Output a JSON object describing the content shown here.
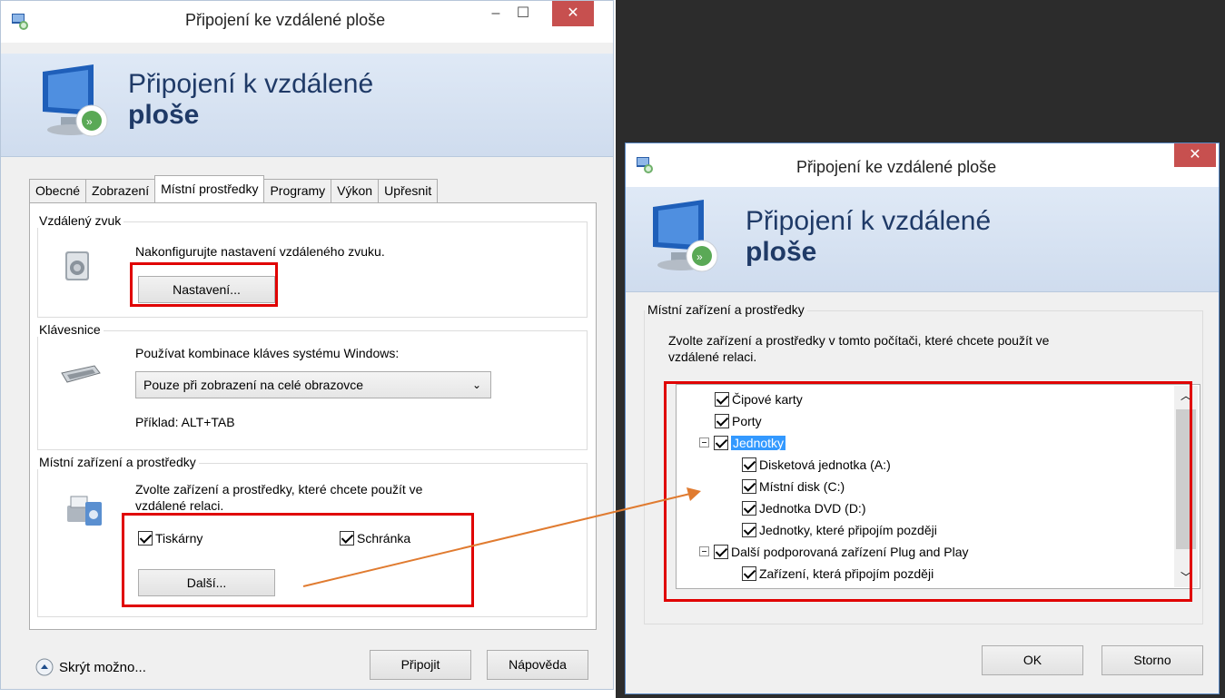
{
  "left_window": {
    "title": "Připojení ke vzdálené ploše",
    "banner_line1": "Připojení k vzdálené",
    "banner_line2": "ploše",
    "tabs": [
      "Obecné",
      "Zobrazení",
      "Místní prostředky",
      "Programy",
      "Výkon",
      "Upřesnit"
    ],
    "active_tab": "Místní prostředky",
    "audio": {
      "label": "Vzdálený zvuk",
      "description": "Nakonfigurujte nastavení vzdáleného zvuku.",
      "button": "Nastavení..."
    },
    "keyboard": {
      "label": "Klávesnice",
      "description": "Používat kombinace kláves systému Windows:",
      "selected": "Pouze při zobrazení na celé obrazovce",
      "example": "Příklad: ALT+TAB"
    },
    "local": {
      "label": "Místní zařízení a prostředky",
      "description_line1": "Zvolte zařízení a prostředky, které chcete použít ve",
      "description_line2": "vzdálené relaci.",
      "printers": "Tiskárny",
      "clipboard": "Schránka",
      "more_button": "Další..."
    },
    "footer": {
      "hide_options": "Skrýt možno...",
      "connect": "Připojit",
      "help": "Nápověda"
    }
  },
  "right_window": {
    "title": "Připojení ke vzdálené ploše",
    "banner_line1": "Připojení k vzdálené",
    "banner_line2": "ploše",
    "group_label": "Místní zařízení a prostředky",
    "description_line1": "Zvolte zařízení a prostředky v tomto počítači, které chcete použít ve",
    "description_line2": "vzdálené relaci.",
    "tree": [
      {
        "label": "Čipové karty",
        "checked": true
      },
      {
        "label": "Porty",
        "checked": true
      },
      {
        "label": "Jednotky",
        "checked": true
      },
      {
        "label": "Disketová jednotka (A:)",
        "checked": true
      },
      {
        "label": "Místní disk (C:)",
        "checked": true
      },
      {
        "label": "Jednotka DVD (D:)",
        "checked": true
      },
      {
        "label": "Jednotky, které připojím později",
        "checked": true
      },
      {
        "label": "Další podporovaná zařízení Plug and Play",
        "checked": true
      },
      {
        "label": "Zařízení, která připojím později",
        "checked": true
      }
    ],
    "ok": "OK",
    "cancel": "Storno"
  },
  "colors": {
    "highlight_red": "#e00000",
    "arrow_orange": "#e07b30",
    "selection_blue": "#3399ff",
    "close_red": "#c7504f"
  },
  "icons": [
    "app-icon",
    "monitor-icon",
    "close-icon",
    "minimize-icon",
    "maximize-icon",
    "speaker-icon",
    "keyboard-icon",
    "devices-icon",
    "chevron-down-icon",
    "chevron-up-icon",
    "collapse-icon",
    "checkbox-icon",
    "arrow-icon"
  ]
}
